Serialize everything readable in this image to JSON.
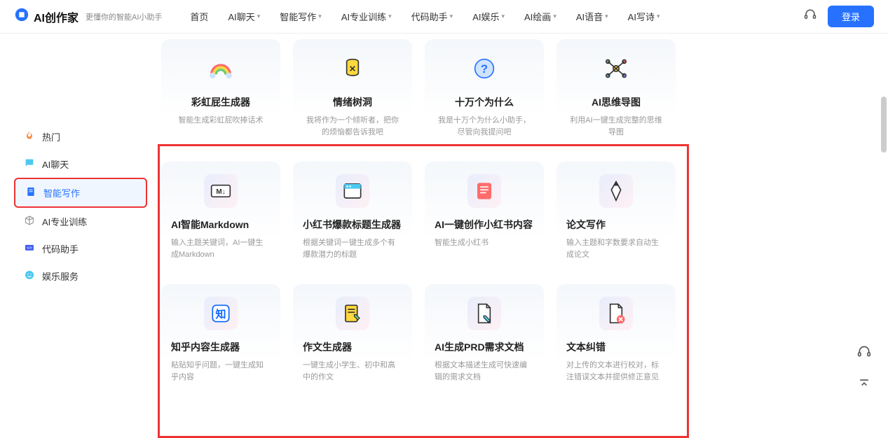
{
  "header": {
    "appName": "AI创作家",
    "tagline": "更懂你的智能AI小助手",
    "nav": [
      "首页",
      "AI聊天",
      "智能写作",
      "AI专业训练",
      "代码助手",
      "AI娱乐",
      "AI绘画",
      "AI语音",
      "AI写诗"
    ],
    "login": "登录"
  },
  "sidebar": {
    "items": [
      {
        "icon": "fire",
        "label": "热门"
      },
      {
        "icon": "chat",
        "label": "AI聊天"
      },
      {
        "icon": "doc",
        "label": "智能写作"
      },
      {
        "icon": "cube",
        "label": "AI专业训练"
      },
      {
        "icon": "code",
        "label": "代码助手"
      },
      {
        "icon": "smile",
        "label": "娱乐服务"
      }
    ],
    "activeIndex": 2
  },
  "rows": [
    [
      {
        "icon": "rainbow",
        "title": "彩虹屁生成器",
        "desc": "智能生成彩虹屁吹捧话术"
      },
      {
        "icon": "can",
        "title": "情绪树洞",
        "desc": "我将作为一个倾听者，把你的烦恼都告诉我吧"
      },
      {
        "icon": "question",
        "title": "十万个为什么",
        "desc": "我是十万个为什么小助手，尽管向我提问吧"
      },
      {
        "icon": "mindmap",
        "title": "AI思维导图",
        "desc": "利用AI一键生成完整的思维导图"
      }
    ],
    [
      {
        "icon": "markdown",
        "title": "AI智能Markdown",
        "desc": "输入主题关键词，AI一键生成Markdown"
      },
      {
        "icon": "window",
        "title": "小红书爆款标题生成器",
        "desc": "根据关键词一键生成多个有爆款潜力的标题"
      },
      {
        "icon": "notepad",
        "title": "AI一键创作小红书内容",
        "desc": "智能生成小红书"
      },
      {
        "icon": "pen",
        "title": "论文写作",
        "desc": "输入主题和字数要求自动生成论文"
      }
    ],
    [
      {
        "icon": "zhi",
        "title": "知乎内容生成器",
        "desc": "粘贴知乎问题，一键生成知乎内容"
      },
      {
        "icon": "compose",
        "title": "作文生成器",
        "desc": "一键生成小学生、初中和高中的作文"
      },
      {
        "icon": "prd",
        "title": "AI生成PRD需求文档",
        "desc": "根据文本描述生成可快速编辑的需求文档"
      },
      {
        "icon": "correct",
        "title": "文本纠错",
        "desc": "对上传的文本进行校对，标注错误文本并提供修正意见"
      }
    ]
  ]
}
